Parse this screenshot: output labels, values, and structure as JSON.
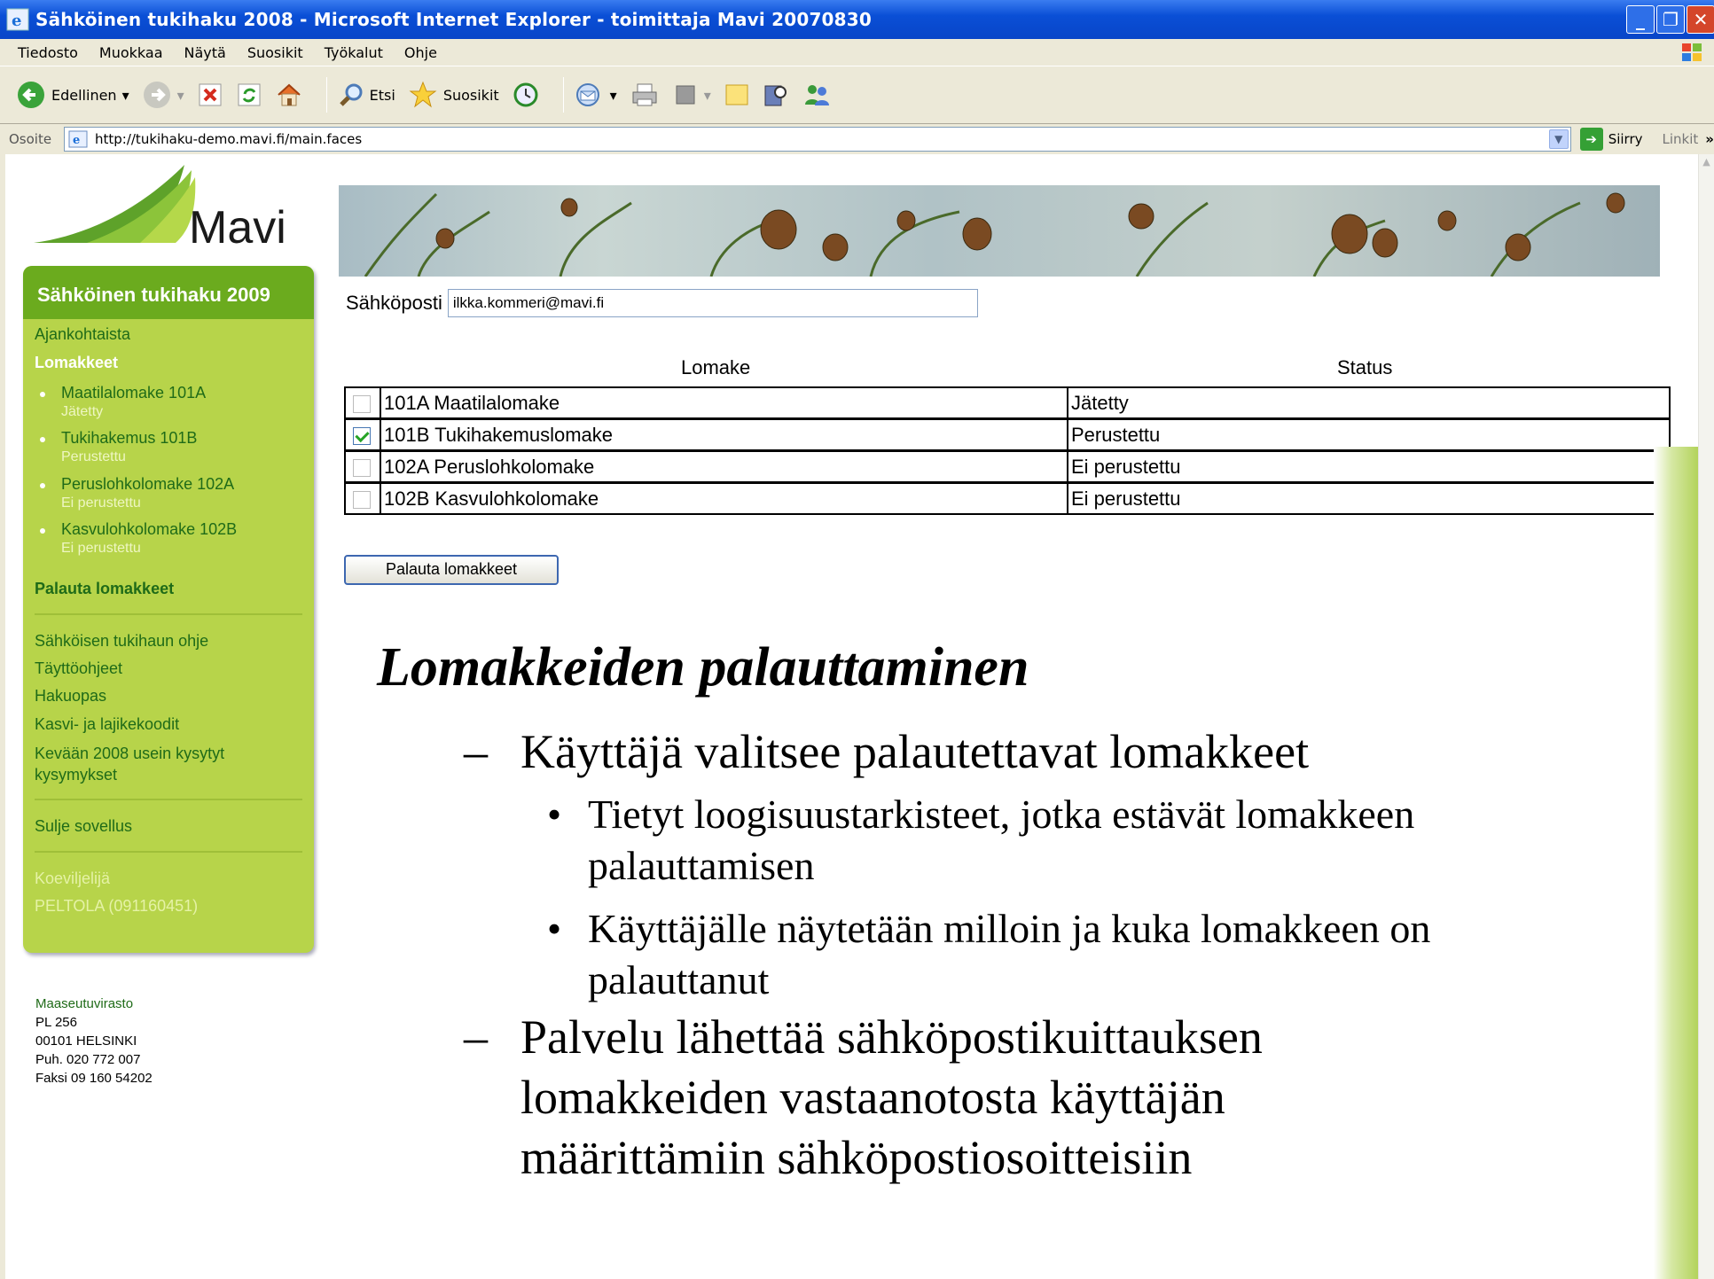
{
  "window": {
    "title": "Sähköinen tukihaku 2008 - Microsoft Internet Explorer - toimittaja Mavi 20070830",
    "min": "_",
    "max": "❐",
    "close": "✕"
  },
  "menu": [
    "Tiedosto",
    "Muokkaa",
    "Näytä",
    "Suosikit",
    "Työkalut",
    "Ohje"
  ],
  "toolbar": {
    "back": "Edellinen",
    "search": "Etsi",
    "favorites": "Suosikit"
  },
  "address": {
    "label": "Osoite",
    "url": "http://tukihaku-demo.mavi.fi/main.faces",
    "go": "Siirry",
    "links": "Linkit",
    "more": "»"
  },
  "logo": {
    "text": "Mavi"
  },
  "sidebar": {
    "title": "Sähköinen tukihaku 2009",
    "current": "Ajankohtaista",
    "forms_heading": "Lomakkeet",
    "forms": [
      {
        "label": "Maatilalomake 101A",
        "status": "Jätetty"
      },
      {
        "label": "Tukihakemus 101B",
        "status": "Perustettu"
      },
      {
        "label": "Peruslohkolomake 102A",
        "status": "Ei perustettu"
      },
      {
        "label": "Kasvulohkolomake 102B",
        "status": "Ei perustettu"
      }
    ],
    "return_forms": "Palauta lomakkeet",
    "help": [
      "Sähköisen tukihaun ohje",
      "Täyttöohjeet",
      "Hakuopas",
      "Kasvi- ja lajikekoodit",
      "Kevään 2008 usein kysytyt kysymykset"
    ],
    "close_app": "Sulje sovellus",
    "user_role": "Koeviljelijä",
    "user_name": "PELTOLA (091160451)"
  },
  "agency": [
    "Maaseutuvirasto",
    "PL 256",
    "00101 HELSINKI",
    "Puh. 020 772 007",
    "Faksi 09 160 54202"
  ],
  "email": {
    "label": "Sähköposti",
    "value": "ilkka.kommeri@mavi.fi"
  },
  "table": {
    "headers": [
      "Lomake",
      "Status"
    ],
    "rows": [
      {
        "form": "101A Maatilalomake",
        "status": "Jätetty",
        "checked": false
      },
      {
        "form": "101B Tukihakemuslomake",
        "status": "Perustettu",
        "checked": true
      },
      {
        "form": "102A Peruslohkolomake",
        "status": "Ei perustettu",
        "checked": false
      },
      {
        "form": "102B Kasvulohkolomake",
        "status": "Ei perustettu",
        "checked": false
      }
    ]
  },
  "return_button": "Palauta lomakkeet",
  "slide": {
    "title": "Lomakkeiden palauttaminen",
    "dash": "–",
    "bullet": "•",
    "p1": "Käyttäjä valitsee palautettavat lomakkeet",
    "b1a": "Tietyt loogisuustarkisteet, jotka estävät lomakkeen",
    "b1b": "palauttamisen",
    "b2a": "Käyttäjälle näytetään milloin ja kuka lomakkeen on",
    "b2b": "palauttanut",
    "p2a": "Palvelu lähettää sähköpostikuittauksen",
    "p2b": "lomakkeiden vastaanotosta käyttäjän",
    "p2c": "määrittämiin sähköpostiosoitteisiin"
  },
  "colors": {
    "sidebar": "#b7d44a",
    "sidebar_head": "#6bab1e",
    "link": "#1f6b18",
    "titlebar": "#0a4fd6"
  }
}
